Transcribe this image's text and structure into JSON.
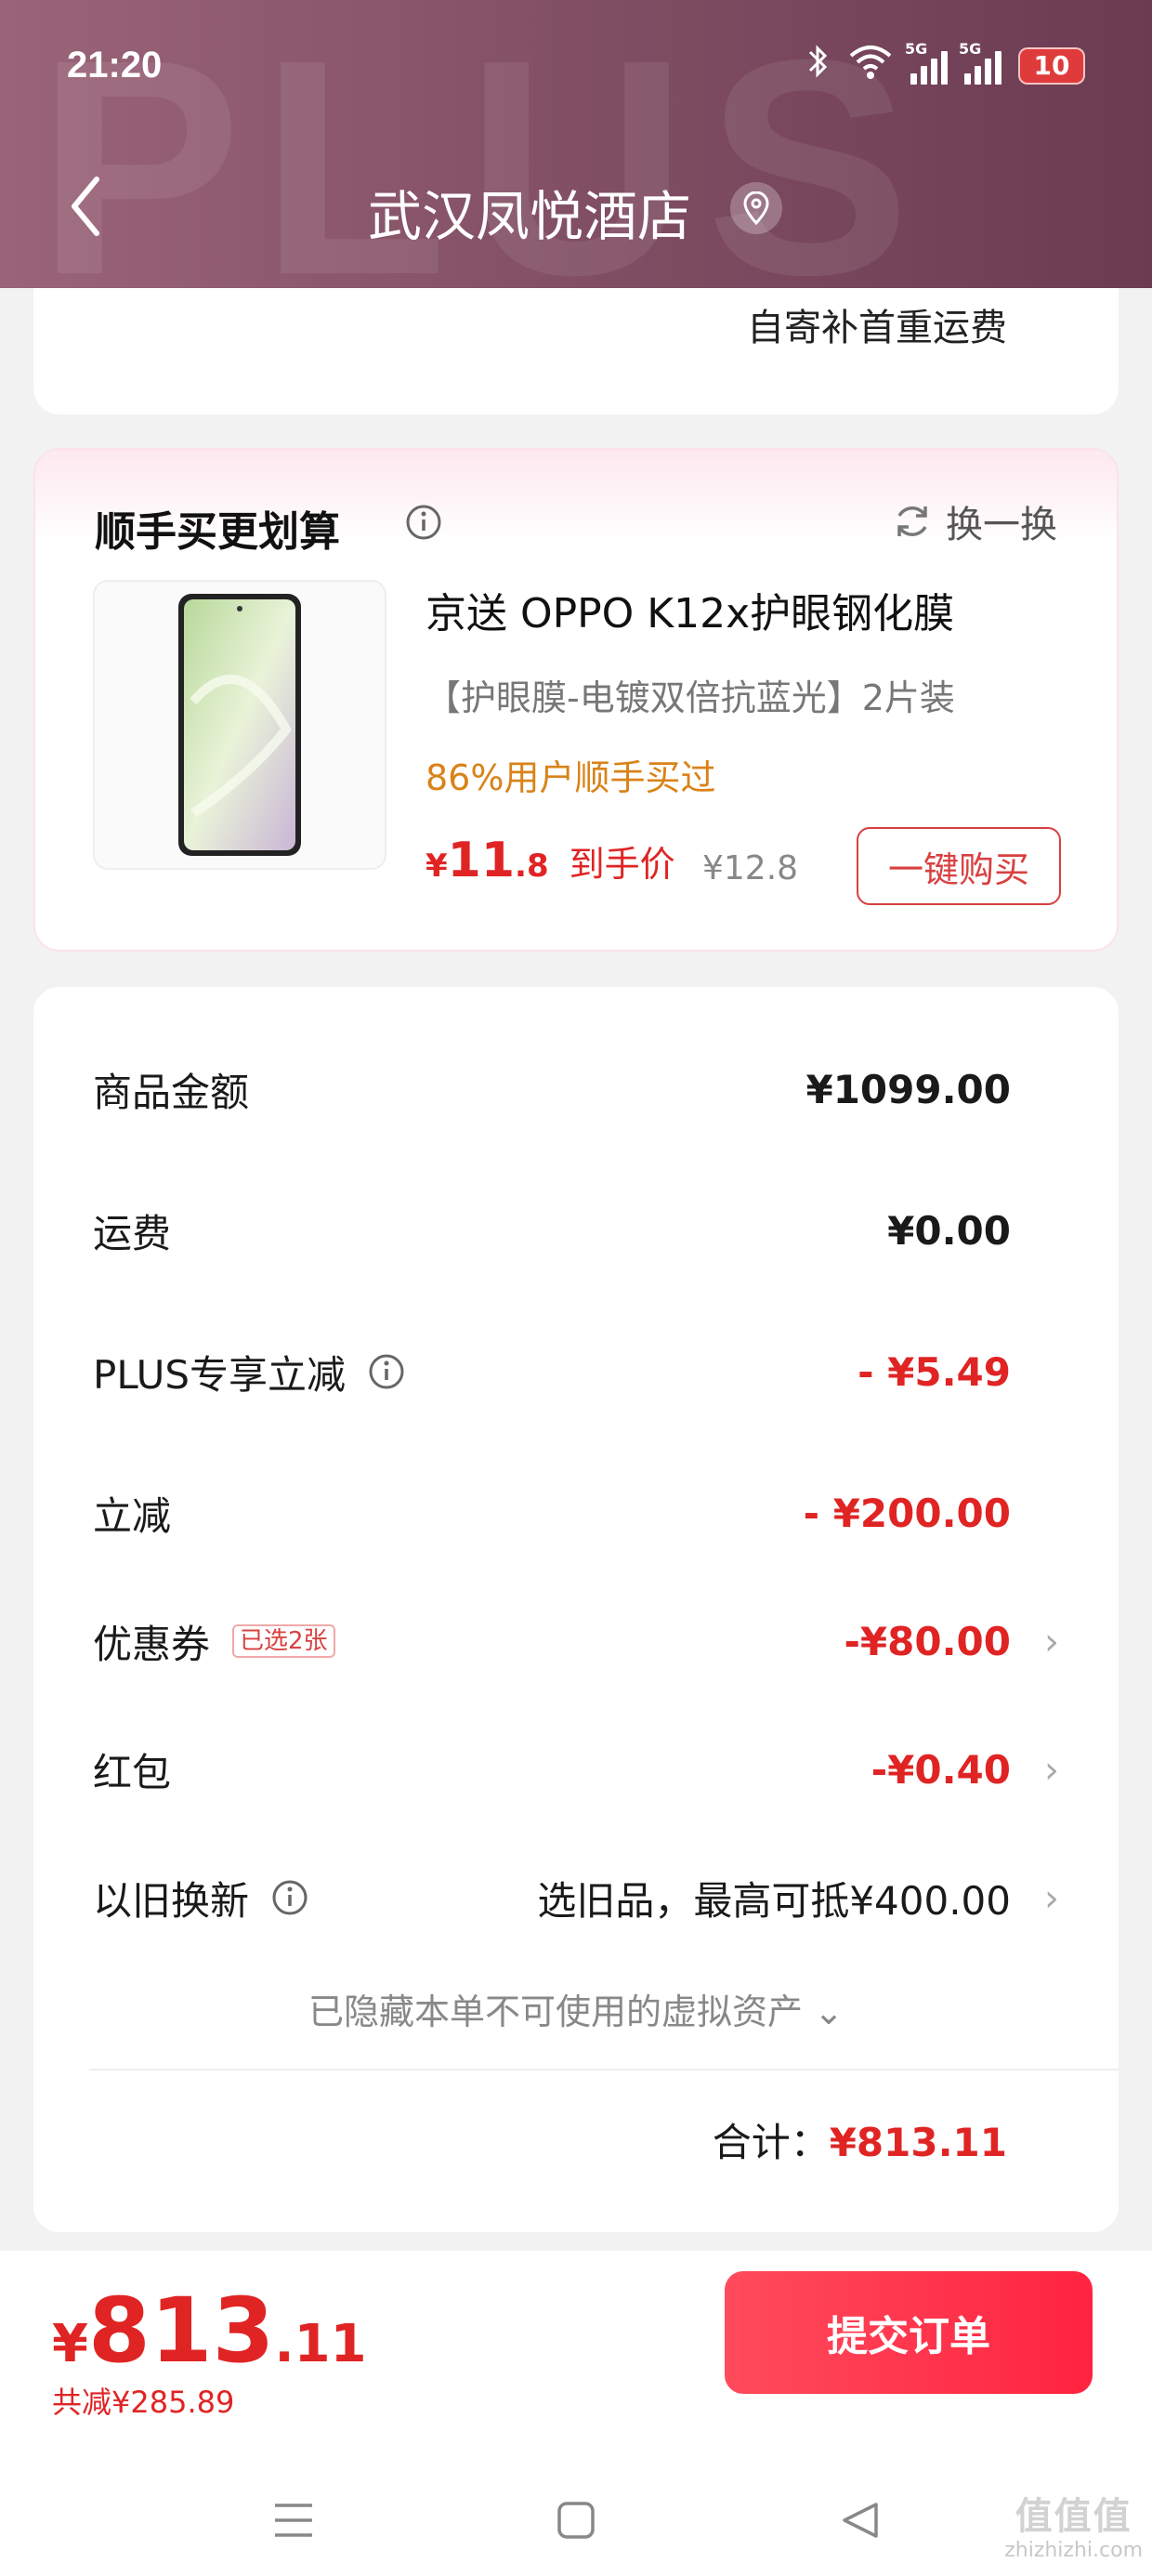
{
  "status_bar": {
    "time": "21:20",
    "network_1": "5G",
    "network_2": "5G",
    "battery": "10"
  },
  "header": {
    "title": "武汉凤悦酒店",
    "watermark": "PLUS",
    "back_icon": "chevron-left-icon",
    "location_icon": "location-pin-icon"
  },
  "shipping": {
    "text": "自寄补首重运费"
  },
  "addon": {
    "title": "顺手买更划算",
    "swap_label": "换一换",
    "product": {
      "name": "京送 OPPO K12x护眼钢化膜",
      "spec": "【护眼膜-电镀双倍抗蓝光】2片装",
      "bought_rate": "86%用户顺手买过",
      "currency": "¥",
      "price_int": "11",
      "price_dec": ".8",
      "price_label": "到手价",
      "original_price": "¥12.8",
      "buy_label": "一键购买"
    }
  },
  "summary": {
    "rows": [
      {
        "label": "商品金额",
        "value": "¥1099.00"
      },
      {
        "label": "运费",
        "value": "¥0.00"
      },
      {
        "label": "PLUS专享立减",
        "value": "- ¥5.49"
      },
      {
        "label": "立减",
        "value": "- ¥200.00"
      },
      {
        "label": "优惠券",
        "chip": "已选2张",
        "value": "-¥80.00"
      },
      {
        "label": "红包",
        "value": "-¥0.40"
      },
      {
        "label": "以旧换新",
        "value": "选旧品，最高可抵¥400.00"
      }
    ],
    "hidden_assets": "已隐藏本单不可使用的虚拟资产",
    "total_label": "合计：",
    "total_value": "¥813.11"
  },
  "bottom": {
    "currency": "¥",
    "price_int": "813",
    "price_dec": ".11",
    "saved": "共减¥285.89",
    "submit_label": "提交订单"
  },
  "watermark_site": {
    "big": "值值值",
    "small": "zhizhizhi.com"
  },
  "colors": {
    "accent_red": "#e02424",
    "header_start": "#9a6478",
    "header_end": "#6b3b52",
    "orange": "#d98318"
  }
}
